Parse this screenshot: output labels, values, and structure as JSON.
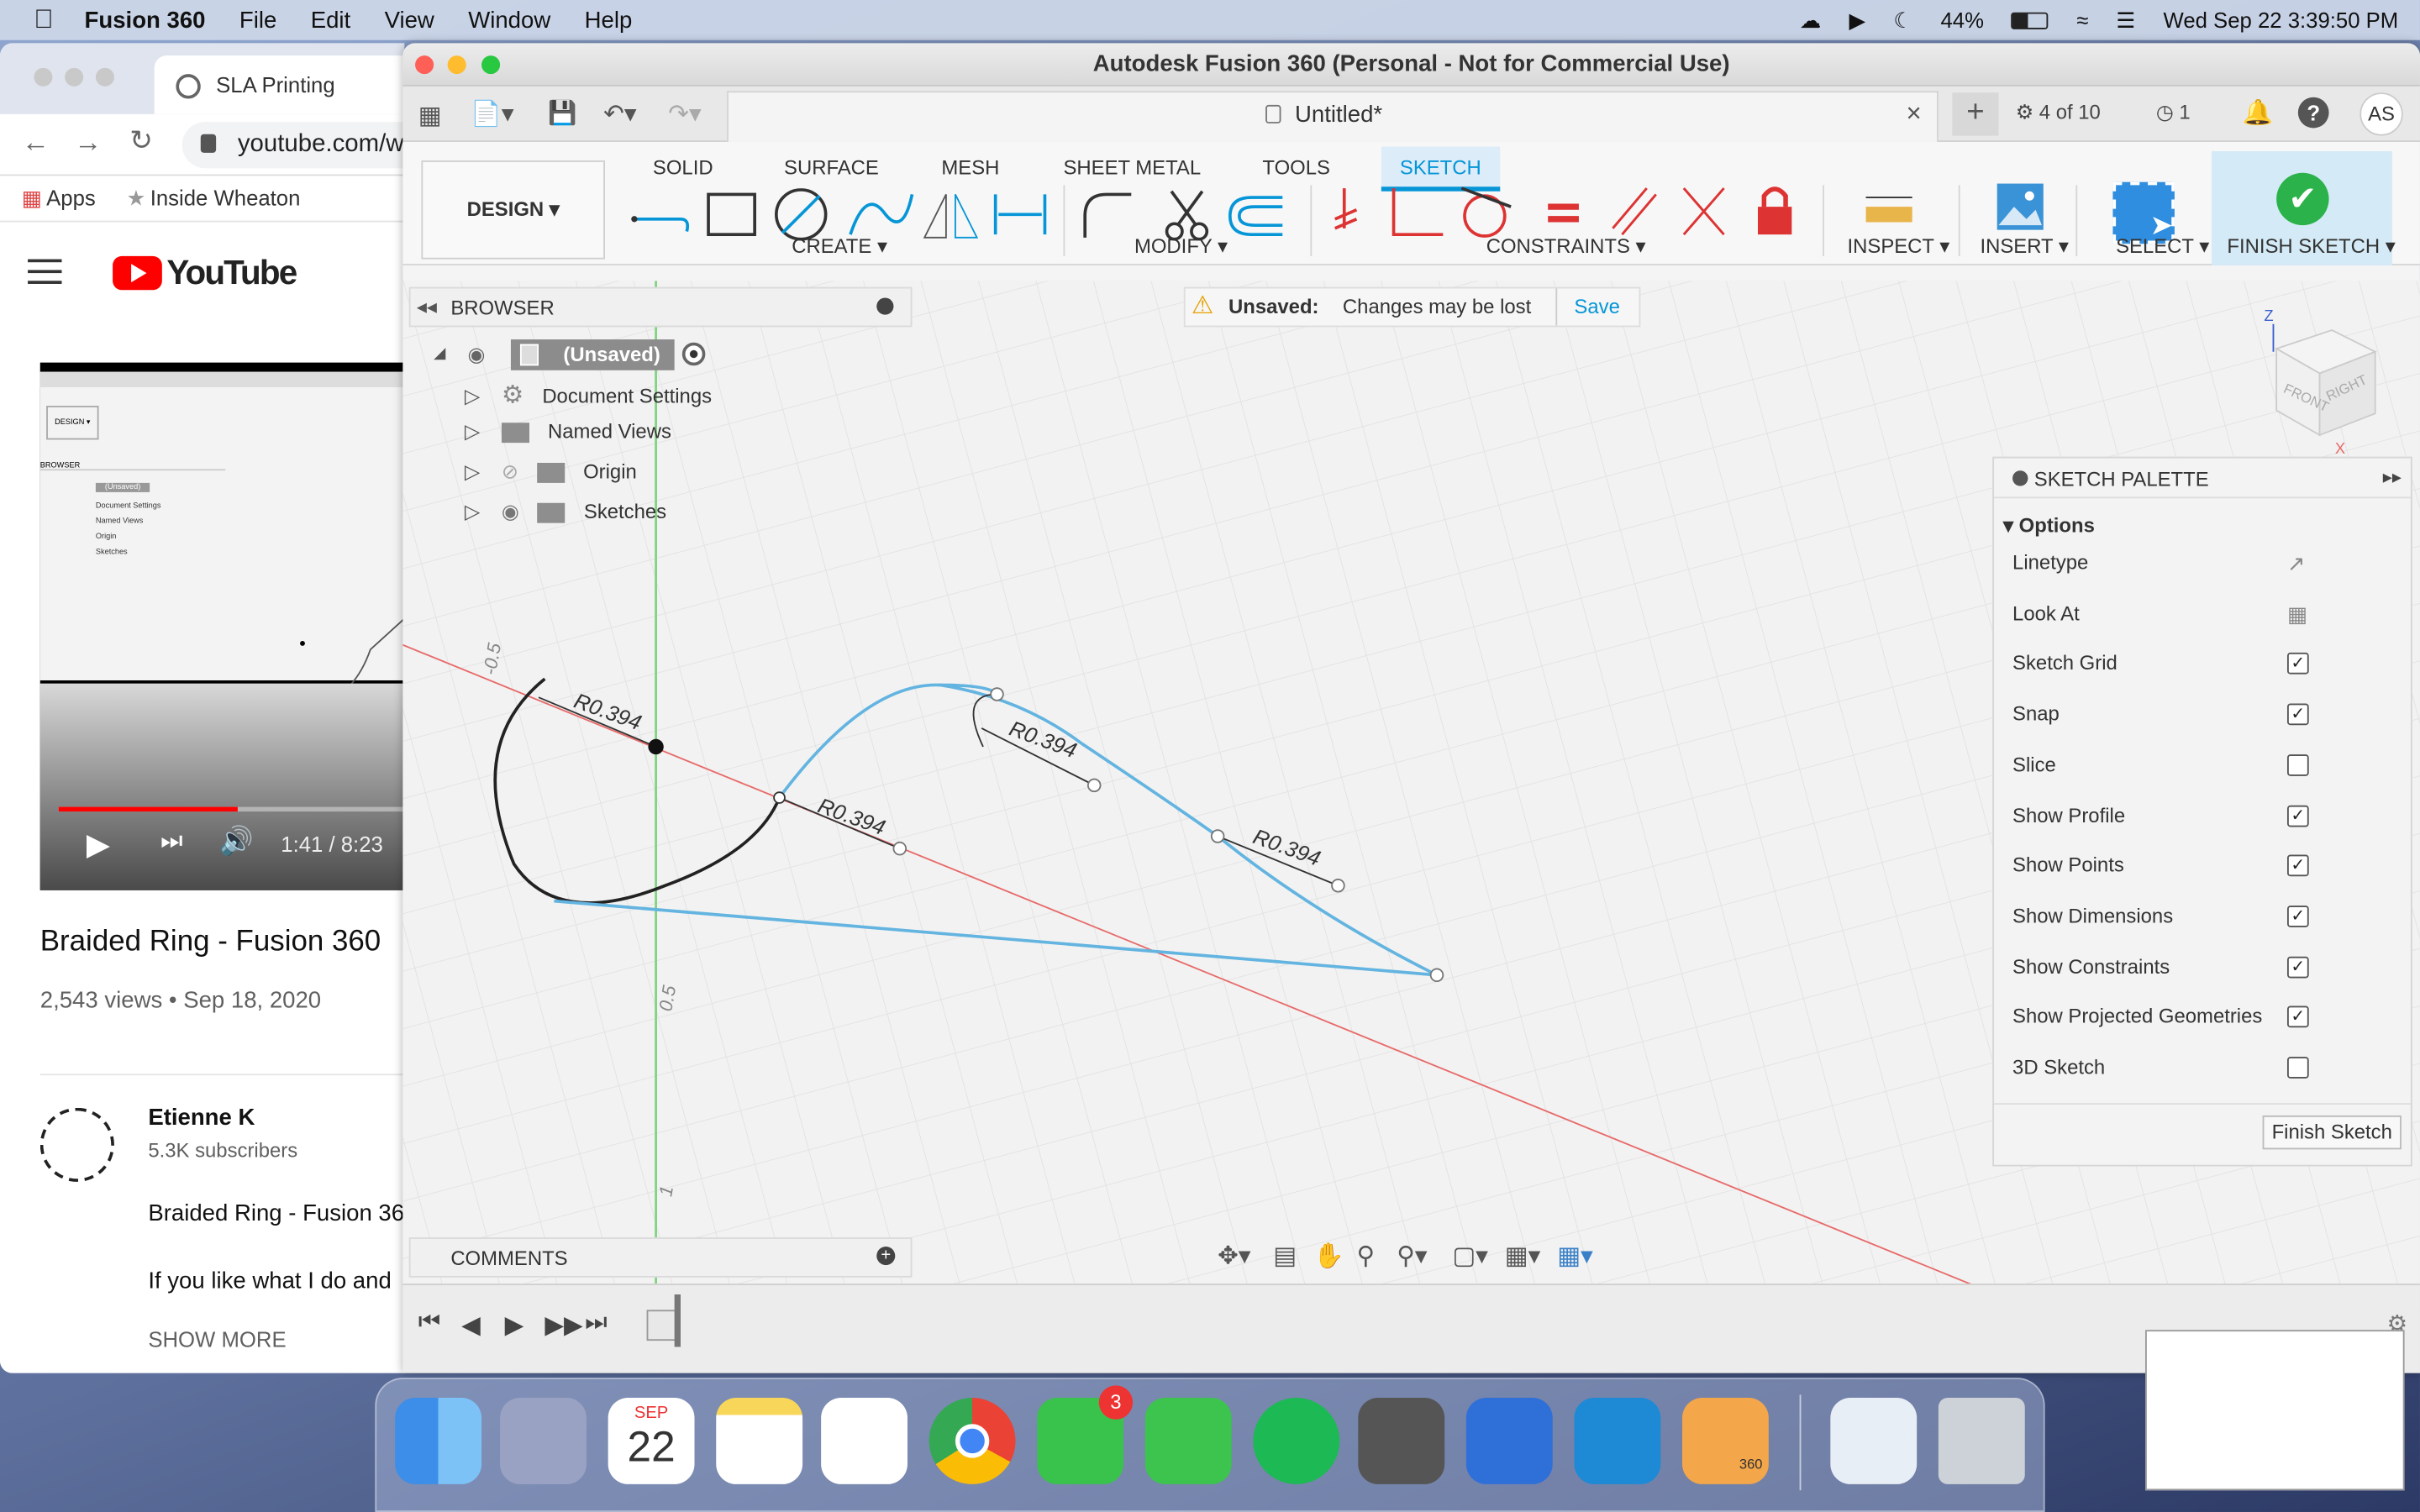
{
  "menubar": {
    "app": "Fusion 360",
    "items": [
      "File",
      "Edit",
      "View",
      "Window",
      "Help"
    ],
    "battery": "44%",
    "datetime": "Wed Sep 22  3:39:50 PM"
  },
  "browser": {
    "tab_title": "SLA Printing",
    "url": "youtube.com/w",
    "bookmarks": [
      "Apps",
      "Inside Wheaton"
    ],
    "site": "YouTube",
    "player_time": "1:41 / 8:23",
    "video_title": "Braided Ring - Fusion 360",
    "views": "2,543 views • Sep 18, 2020",
    "channel": "Etienne K",
    "subscribers": "5.3K subscribers",
    "desc_title": "Braided Ring - Fusion 36",
    "desc_line": "If you like what I do and",
    "show_more": "SHOW MORE",
    "thumb_browser": "BROWSER",
    "thumb_unsaved": "(Unsaved)",
    "thumb_items": [
      "Document Settings",
      "Named Views",
      "Origin",
      "Sketches"
    ]
  },
  "fusion": {
    "title": "Autodesk Fusion 360 (Personal - Not for Commercial Use)",
    "doc_tab": "Untitled*",
    "jobs": "4 of 10",
    "notif_count": "1",
    "user": "AS",
    "workspace": "DESIGN ▾",
    "ribbon_tabs": [
      "SOLID",
      "SURFACE",
      "MESH",
      "SHEET METAL",
      "TOOLS",
      "SKETCH"
    ],
    "groups": {
      "create": "CREATE ▾",
      "modify": "MODIFY ▾",
      "constraints": "CONSTRAINTS ▾",
      "inspect": "INSPECT ▾",
      "insert": "INSERT ▾",
      "select": "SELECT ▾",
      "finish": "FINISH SKETCH ▾"
    },
    "unsaved": {
      "label": "Unsaved:",
      "msg": "Changes may be lost",
      "save": "Save"
    },
    "browser": {
      "title": "BROWSER",
      "root": "(Unsaved)",
      "items": [
        "Document Settings",
        "Named Views",
        "Origin",
        "Sketches"
      ]
    },
    "comments": "COMMENTS",
    "dims": [
      "R0.394",
      "R0.394",
      "R0.394",
      "R0.394"
    ],
    "ruler": [
      "-0.5",
      "0.5",
      "1"
    ],
    "viewcube": {
      "front": "FRONT",
      "right": "RIGHT",
      "z": "Z",
      "x": "X"
    },
    "palette": {
      "title": "SKETCH PALETTE",
      "section": "Options",
      "rows": [
        {
          "label": "Linetype",
          "type": "icon"
        },
        {
          "label": "Look At",
          "type": "icon"
        },
        {
          "label": "Sketch Grid",
          "checked": true
        },
        {
          "label": "Snap",
          "checked": true
        },
        {
          "label": "Slice",
          "checked": false
        },
        {
          "label": "Show Profile",
          "checked": true
        },
        {
          "label": "Show Points",
          "checked": true
        },
        {
          "label": "Show Dimensions",
          "checked": true
        },
        {
          "label": "Show Constraints",
          "checked": true
        },
        {
          "label": "Show Projected Geometries",
          "checked": true
        },
        {
          "label": "3D Sketch",
          "checked": false
        }
      ],
      "finish": "Finish Sketch"
    }
  },
  "dock": {
    "cal_month": "SEP",
    "cal_day": "22",
    "messages_badge": "3",
    "fusion_badge": "360"
  },
  "colors": {
    "sketch_blue": "#63b4e0",
    "accent": "#0696d7",
    "red_axis": "#e86a6a",
    "green_axis": "#7fd37f"
  }
}
